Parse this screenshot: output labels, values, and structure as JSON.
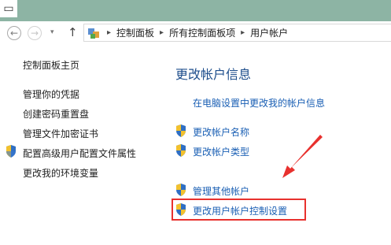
{
  "window": {
    "control_glyph": "▭"
  },
  "address": {
    "crumbs": [
      "控制面板",
      "所有控制面板项",
      "用户帐户"
    ],
    "separator": "▸",
    "dropdown": "▾",
    "back": "←",
    "forward": "→",
    "up": "↑"
  },
  "sidebar": {
    "items": [
      {
        "label": "控制面板主页",
        "shield": false
      },
      {
        "label": "管理你的凭据",
        "shield": false
      },
      {
        "label": "创建密码重置盘",
        "shield": false
      },
      {
        "label": "管理文件加密证书",
        "shield": false
      },
      {
        "label": "配置高级用户配置文件属性",
        "shield": true
      },
      {
        "label": "更改我的环境变量",
        "shield": false
      }
    ]
  },
  "main": {
    "title": "更改帐户信息",
    "links": [
      {
        "label": "在电脑设置中更改我的帐户信息",
        "shield": false
      },
      {
        "label": "更改帐户名称",
        "shield": true
      },
      {
        "label": "更改帐户类型",
        "shield": true
      },
      {
        "label": "管理其他帐户",
        "shield": true
      },
      {
        "label": "更改用户帐户控制设置",
        "shield": true
      }
    ]
  },
  "colors": {
    "annotation": "#e8312e",
    "link": "#1a5fb4",
    "heading": "#1e4e8c"
  }
}
